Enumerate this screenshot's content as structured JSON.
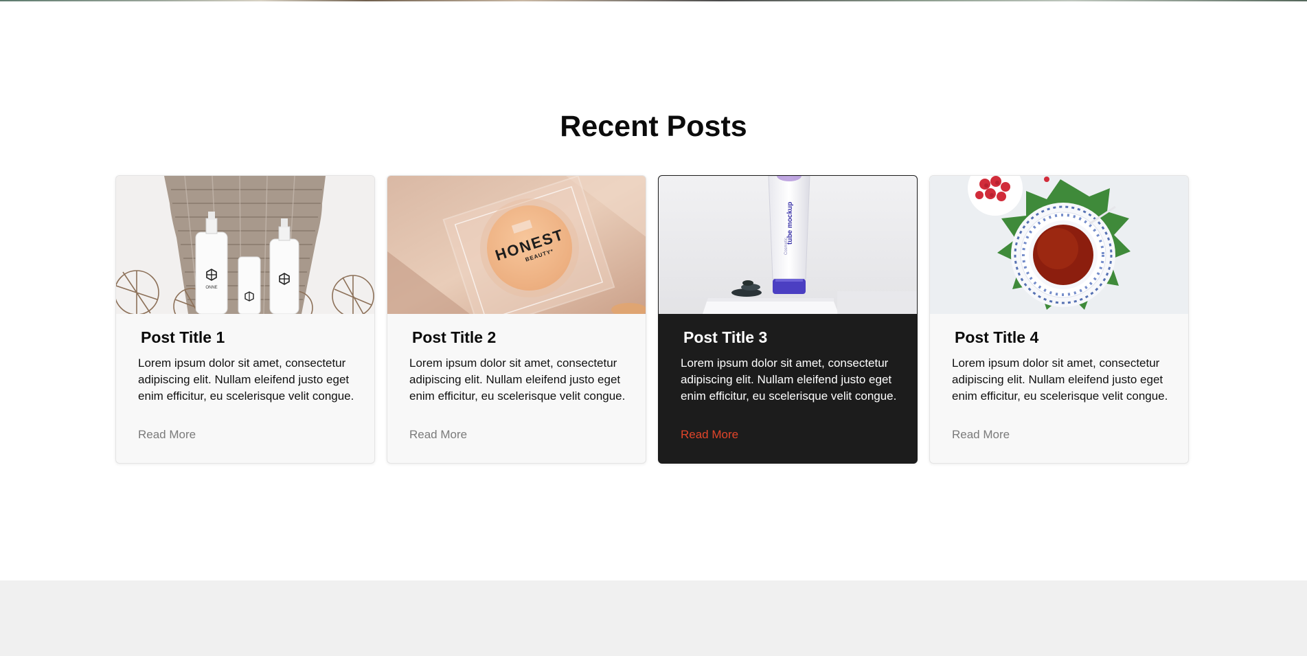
{
  "section": {
    "title": "Recent Posts"
  },
  "posts": [
    {
      "title": "Post Title 1",
      "excerpt": "Lorem ipsum dolor sit amet, consectetur adipiscing elit. Nullam eleifend justo eget enim efficitur, eu scelerisque velit congue.",
      "read_more": "Read More",
      "image": {
        "bottle_brand": "ONNE"
      }
    },
    {
      "title": "Post Title 2",
      "excerpt": "Lorem ipsum dolor sit amet, consectetur adipiscing elit. Nullam eleifend justo eget enim efficitur, eu scelerisque velit congue.",
      "read_more": "Read More",
      "image": {
        "brand": "HONEST",
        "sub": "BEAUTY*"
      }
    },
    {
      "title": "Post Title 3",
      "excerpt": "Lorem ipsum dolor sit amet, consectetur adipiscing elit. Nullam eleifend justo eget enim efficitur, eu scelerisque velit congue.",
      "read_more": "Read More",
      "image": {
        "tube_label": "tube mockup",
        "tube_sub": "Cosmetic"
      }
    },
    {
      "title": "Post Title 4",
      "excerpt": "Lorem ipsum dolor sit amet, consectetur adipiscing elit. Nullam eleifend justo eget enim efficitur, eu scelerisque velit congue.",
      "read_more": "Read More",
      "image": {}
    }
  ],
  "colors": {
    "accent": "#e2452a",
    "dark_card": "#1c1c1c",
    "card_bg": "#f8f8f8",
    "footer_bg": "#f0f0f0",
    "muted_link": "#7a7a7a"
  }
}
